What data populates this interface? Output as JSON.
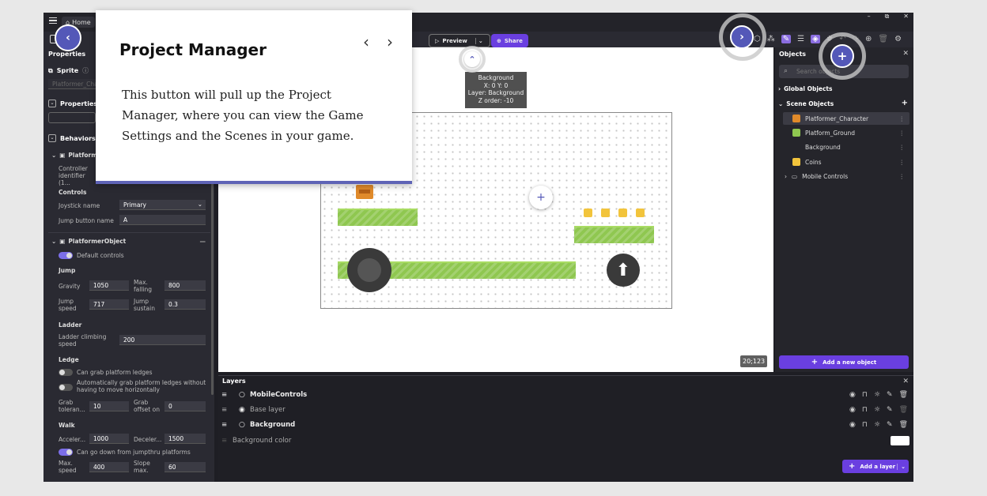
{
  "top": {
    "home": "Home",
    "preview": "Preview",
    "share": "Share"
  },
  "window": {
    "minimize": "–",
    "maximize": "⧉",
    "close": "✕"
  },
  "properties": {
    "title": "Properties",
    "sprite_label": "Sprite",
    "object_name_placeholder": "Platformer_Cha...",
    "properties_section": "Properties",
    "behaviors_section": "Behaviors",
    "platformer_short": "Platform",
    "controller_label": "Controller identifier (1...",
    "controls_group": "Controls",
    "joystick_label": "Joystick name",
    "joystick_value": "Primary",
    "jump_button_label": "Jump button name",
    "jump_button_value": "A",
    "platformer_object": "PlatformerObject",
    "default_controls": "Default controls",
    "jump_group": "Jump",
    "gravity_label": "Gravity",
    "gravity_value": "1050",
    "max_falling_label": "Max. falling",
    "max_falling_value": "800",
    "jump_speed_label": "Jump speed",
    "jump_speed_value": "717",
    "jump_sustain_label": "Jump sustain",
    "jump_sustain_value": "0.3",
    "ladder_group": "Ladder",
    "ladder_speed_label": "Ladder climbing speed",
    "ladder_speed_value": "200",
    "ledge_group": "Ledge",
    "grab_ledges": "Can grab platform ledges",
    "auto_grab": "Automatically grab platform ledges without having to move horizontally",
    "grab_tolerance_label": "Grab toleran...",
    "grab_tolerance_value": "10",
    "grab_offset_label": "Grab offset on",
    "grab_offset_value": "0",
    "walk_group": "Walk",
    "acceleration_label": "Acceler...",
    "acceleration_value": "1000",
    "deceleration_label": "Deceler...",
    "deceleration_value": "1500",
    "jumpthru": "Can go down from jumpthru platforms",
    "max_speed_label": "Max. speed",
    "max_speed_value": "400",
    "slope_max_label": "Slope max.",
    "slope_max_value": "60"
  },
  "canvas": {
    "tooltip": [
      "Background",
      "X: 0  Y: 0",
      "Layer: Background",
      "Z order: -10"
    ],
    "coords": "20;123"
  },
  "objects": {
    "title": "Objects",
    "search_placeholder": "Search objects",
    "global_objects": "Global Objects",
    "scene_objects": "Scene Objects",
    "items": [
      {
        "name": "Platformer_Character",
        "color": "#e08a2a"
      },
      {
        "name": "Platform_Ground",
        "color": "#8fc750"
      },
      {
        "name": "Background",
        "color": ""
      },
      {
        "name": "Coins",
        "color": "#f2c43c"
      },
      {
        "name": "Mobile Controls",
        "color": ""
      }
    ],
    "add_object": "Add a new object"
  },
  "layers": {
    "title": "Layers",
    "rows": [
      "MobileControls",
      "Base layer",
      "Background"
    ],
    "background_color": "Background color",
    "add_layer": "Add a layer"
  },
  "tutorial": {
    "title": "Project Manager",
    "body": "This button will pull up the Project Manager, where you can view the Game Settings and the Scenes in your game."
  },
  "colors": {
    "accent": "#6a3fe0",
    "tutorial_nav": "#5458b8",
    "platform": "#8fc750",
    "coin": "#f2c43c"
  }
}
